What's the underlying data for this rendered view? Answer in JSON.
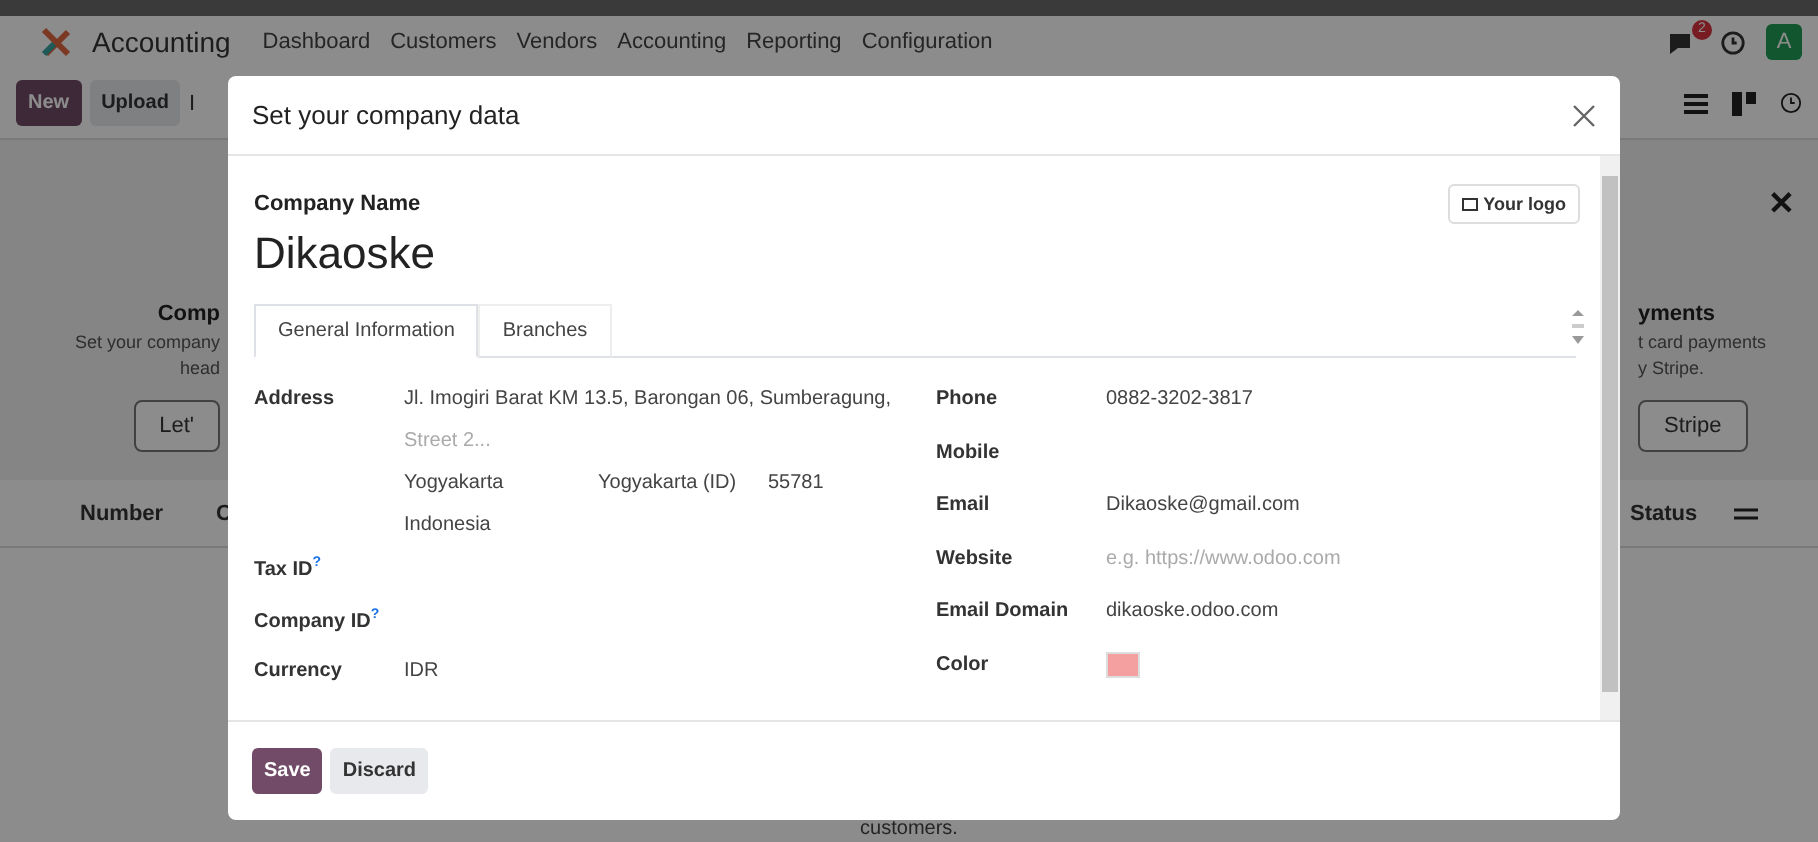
{
  "navbar": {
    "app": "Accounting",
    "menus": [
      "Dashboard",
      "Customers",
      "Vendors",
      "Accounting",
      "Reporting",
      "Configuration"
    ],
    "chat_badge": "2",
    "avatar": "A"
  },
  "control_bar": {
    "buttons": [
      {
        "label": "New",
        "kind": "primary"
      },
      {
        "label": "Upload",
        "kind": "secondary"
      }
    ],
    "cut_text": "I"
  },
  "banner": {
    "left": {
      "title": "Comp",
      "lines": [
        "Set your company",
        "head"
      ],
      "button": "Let'"
    },
    "right": {
      "title": "yments",
      "lines": [
        "t card payments",
        "y Stripe."
      ],
      "button": "Stripe"
    },
    "close": "✕"
  },
  "list": {
    "columns": [
      "Number",
      "C",
      "Status"
    ],
    "footer_text": "customers."
  },
  "modal": {
    "title": "Set your company data",
    "company_name_label": "Company Name",
    "company_name": "Dikaoske",
    "logo_button": "Your logo",
    "tabs": [
      {
        "label": "General Information",
        "selected": true
      },
      {
        "label": "Branches",
        "selected": false
      }
    ],
    "left_fields": [
      {
        "kind": "address",
        "label": "Address",
        "street": "Jl. Imogiri Barat KM 13.5, Barongan 06, Sumberagung,",
        "street2_placeholder": "Street 2...",
        "city": "Yogyakarta",
        "state": "Yogyakarta (ID)",
        "zip": "55781",
        "country": "Indonesia"
      },
      {
        "kind": "text",
        "label": "Tax ID",
        "help": "?"
      },
      {
        "kind": "text",
        "label": "Company ID",
        "help": "?"
      },
      {
        "kind": "text",
        "label": "Currency",
        "value": "IDR"
      }
    ],
    "right_fields": [
      {
        "kind": "text",
        "label": "Phone",
        "value": "0882-3202-3817"
      },
      {
        "kind": "text",
        "label": "Mobile"
      },
      {
        "kind": "text",
        "label": "Email",
        "value": "Dikaoske@gmail.com"
      },
      {
        "kind": "text",
        "label": "Website",
        "placeholder": "e.g. https://www.odoo.com"
      },
      {
        "kind": "text",
        "label": "Email Domain",
        "value": "dikaoske.odoo.com"
      },
      {
        "kind": "color",
        "label": "Color",
        "color": "#f4a0a0"
      }
    ],
    "footer_buttons": [
      {
        "label": "Save",
        "kind": "primary"
      },
      {
        "label": "Discard",
        "kind": "secondary"
      }
    ]
  }
}
